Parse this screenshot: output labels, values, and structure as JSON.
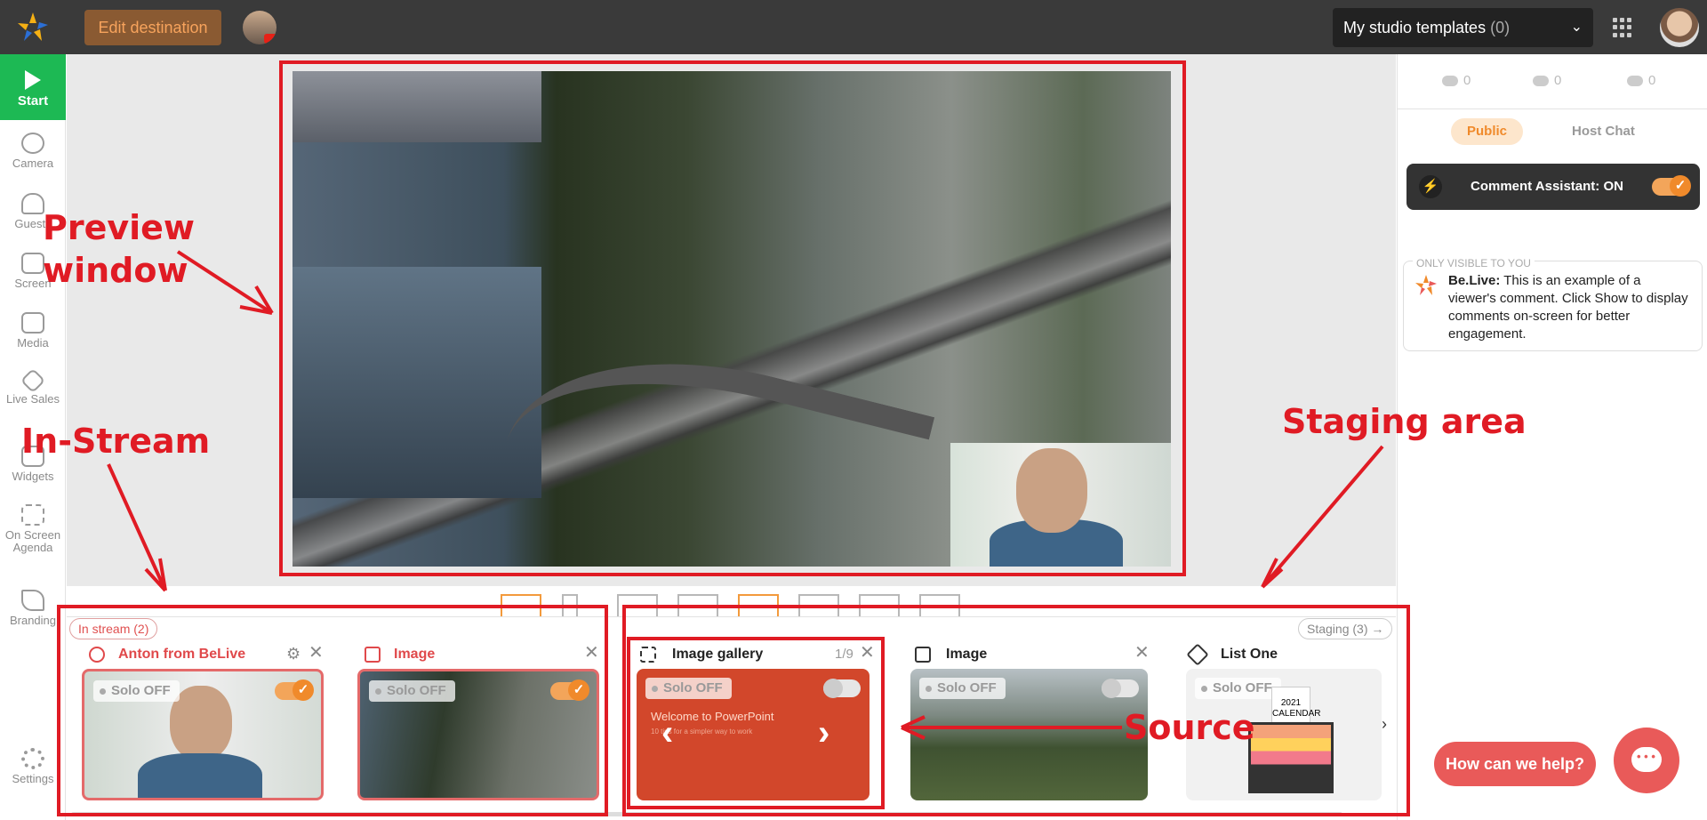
{
  "topbar": {
    "edit_destination_label": "Edit destination",
    "templates_label": "My studio templates",
    "templates_count": "(0)"
  },
  "sidebar": {
    "start_label": "Start",
    "items": [
      {
        "label": "Camera",
        "icon": "camera-icon"
      },
      {
        "label": "Guests",
        "icon": "guests-icon"
      },
      {
        "label": "Screen",
        "icon": "screen-icon"
      },
      {
        "label": "Media",
        "icon": "media-icon"
      },
      {
        "label": "Live Sales",
        "icon": "tag-icon"
      },
      {
        "label": "Widgets",
        "icon": "widgets-icon"
      },
      {
        "label": "On Screen Agenda",
        "icon": "agenda-icon"
      },
      {
        "label": "Branding",
        "icon": "brush-icon"
      }
    ],
    "settings_label": "Settings"
  },
  "in_stream": {
    "chip_label": "In stream (2)",
    "cards": [
      {
        "title": "Anton from BeLive",
        "solo": "Solo OFF"
      },
      {
        "title": "Image",
        "solo": "Solo OFF"
      }
    ]
  },
  "staging": {
    "chip_label": "Staging (3) →",
    "cards": [
      {
        "title": "Image gallery",
        "counter": "1/9",
        "solo": "Solo OFF",
        "slide_title": "Welcome to PowerPoint",
        "slide_subtitle": "10 tips for a simpler way to work"
      },
      {
        "title": "Image",
        "solo": "Solo OFF"
      },
      {
        "title": "List One",
        "solo": "Solo OFF",
        "calendar_text": "2021 CALENDAR"
      }
    ]
  },
  "right_panel": {
    "views": "0",
    "likes": "0",
    "dislikes": "0",
    "tab_public": "Public",
    "tab_host_chat": "Host Chat",
    "assistant_label": "Comment Assistant: ON",
    "only_visible": "ONLY VISIBLE TO YOU",
    "comment_author": "Be.Live:",
    "comment_text": "This is an example of a viewer's comment. Click Show to display comments on-screen for better engagement."
  },
  "help": {
    "label": "How can we help?"
  },
  "annotations": {
    "preview": "Preview\nwindow",
    "in_stream": "In-Stream",
    "staging": "Staging area",
    "source": "Source"
  },
  "colors": {
    "accent": "#f08a2b",
    "start_green": "#1db954",
    "annotation_red": "#e01b24",
    "help_red": "#e95a59"
  }
}
